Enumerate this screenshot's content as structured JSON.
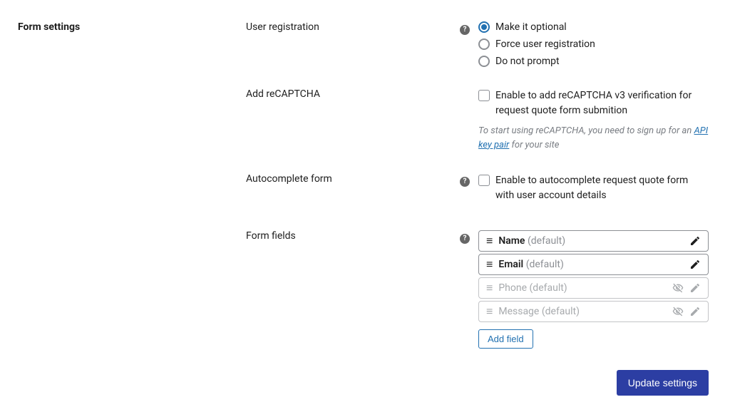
{
  "section_title": "Form settings",
  "user_registration": {
    "label": "User registration",
    "options": {
      "optional": "Make it optional",
      "force": "Force user registration",
      "no_prompt": "Do not prompt"
    }
  },
  "recaptcha": {
    "label": "Add reCAPTCHA",
    "checkbox_label": "Enable to add reCAPTCHA v3 verification for request quote form submition",
    "helper_pre": "To start using reCAPTCHA, you need to sign up for an ",
    "helper_link": "API key pair",
    "helper_post": " for your site"
  },
  "autocomplete": {
    "label": "Autocomplete form",
    "checkbox_label": "Enable to autocomplete request quote form with user account details"
  },
  "form_fields": {
    "label": "Form fields",
    "default_suffix": "(default)",
    "items": {
      "name": "Name",
      "email": "Email",
      "phone": "Phone",
      "message": "Message"
    },
    "add_button": "Add field"
  },
  "update_button": "Update settings"
}
